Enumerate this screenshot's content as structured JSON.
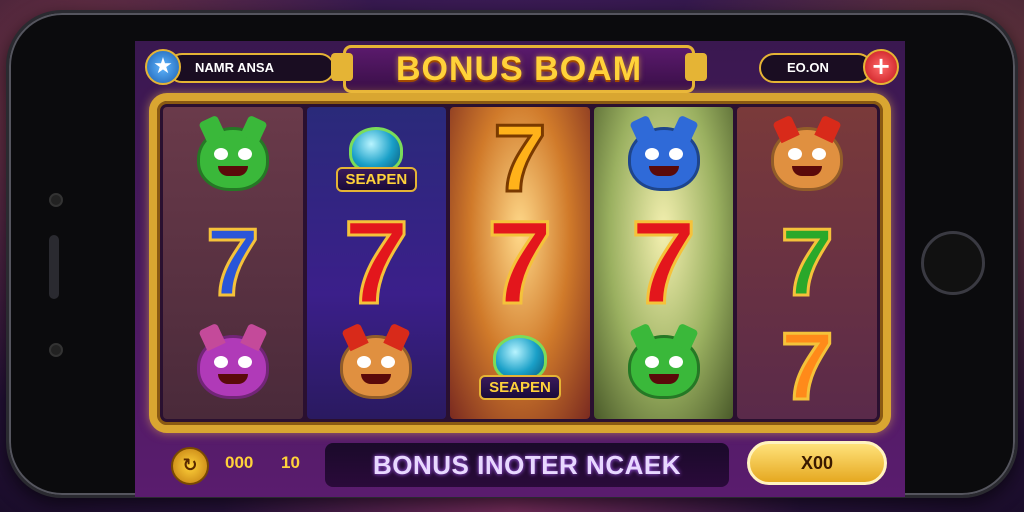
{
  "header": {
    "player_name": "NAΜR ANSA",
    "title": "BONUS BOAM",
    "coins": "EO.ON",
    "add_icon": "plus-icon",
    "star_icon": "star-icon"
  },
  "reels": [
    [
      "creature-green",
      "seven-blue",
      "creature-purple"
    ],
    [
      "gem-seapen",
      "seven-red",
      "creature-red"
    ],
    [
      "seven-gold",
      "seven-red",
      "gem-seapen"
    ],
    [
      "creature-blue",
      "seven-red",
      "creature-green"
    ],
    [
      "creature-red",
      "seven-green",
      "seven-orange"
    ]
  ],
  "symbols": {
    "seven_glyph": "7",
    "gem_label": "SEAPEN"
  },
  "footer": {
    "win": "000",
    "bet": "10",
    "banner": "BONUS INOTER NCAEK",
    "multiplier": "X00",
    "spin_icon": "spin-coin-icon"
  },
  "colors": {
    "gold": "#e5b435",
    "title": "#ffd23a",
    "seven_red": "#e3161c"
  }
}
